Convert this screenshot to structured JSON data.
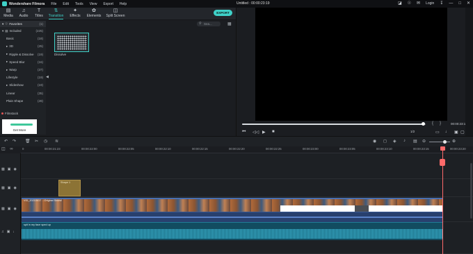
{
  "app": {
    "name": "Wondershare Filmora",
    "menu": [
      "File",
      "Edit",
      "Tools",
      "View",
      "Export",
      "Help"
    ],
    "doc_title": "Untitled : 00:00:23:19",
    "login": "Login"
  },
  "toolbar": {
    "tabs": [
      {
        "label": "Media",
        "icon": "folder-icon"
      },
      {
        "label": "Audio",
        "icon": "music-note-icon"
      },
      {
        "label": "Titles",
        "icon": "text-icon"
      },
      {
        "label": "Transition",
        "icon": "transition-icon",
        "active": true
      },
      {
        "label": "Effects",
        "icon": "effects-icon"
      },
      {
        "label": "Elements",
        "icon": "elements-icon"
      },
      {
        "label": "Split Screen",
        "icon": "split-screen-icon"
      }
    ],
    "export_label": "EXPORT"
  },
  "sidebar": {
    "favorites_label": "Favorites",
    "favorites_count": "(1)",
    "items": [
      {
        "label": "Included",
        "count": "(225)"
      },
      {
        "label": "Basic",
        "count": "(18)"
      },
      {
        "label": "3D",
        "count": "(25)"
      },
      {
        "label": "Ripple & Dissolve",
        "count": "(19)"
      },
      {
        "label": "Speed Blur",
        "count": "(16)"
      },
      {
        "label": "Warp",
        "count": "(37)"
      },
      {
        "label": "Lifestyle",
        "count": "(19)"
      },
      {
        "label": "Slideshow",
        "count": "(19)"
      },
      {
        "label": "Linear",
        "count": "(35)"
      },
      {
        "label": "Plain Shape",
        "count": "(28)"
      }
    ],
    "filmstock_label": "Filmstock",
    "get_more_label": "Get More"
  },
  "browser": {
    "search_placeholder": "Sea...",
    "items": [
      {
        "label": "Dissolve"
      }
    ]
  },
  "preview": {
    "timecode": "00:00:23:19",
    "ratio": "1/2",
    "progress": 0.99
  },
  "timeline": {
    "ruler_ticks": [
      "0",
      "00:00:21:23",
      "00:00:22:00",
      "00:00:22:05",
      "00:00:22:10",
      "00:00:22:15",
      "00:00:22:20",
      "00:00:22:25",
      "00:00:23:00",
      "00:00:23:05",
      "00:00:23:10",
      "00:00:23:15",
      "00:00:23:20"
    ],
    "clips": {
      "overlay_label": "Shape 1",
      "video_label": "VID_20210417 ...Original Sound",
      "music_label": "spit in my face sped up"
    }
  },
  "colors": {
    "accent": "#3fd1c8",
    "playhead": "#ff6a6a",
    "video_clip_border": "#4a6fb0",
    "audio_clip": "#124c60"
  }
}
